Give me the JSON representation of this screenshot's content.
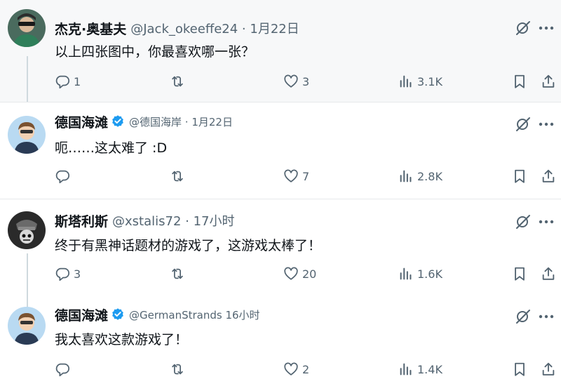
{
  "tweets": [
    {
      "name": "杰克·奥基夫",
      "handle": "@Jack_okeeffe24 · 1月22日",
      "verified": false,
      "text": "以上四张图中，你最喜欢哪一张？",
      "reply_count": "1",
      "retweet_count": "",
      "like_count": "3",
      "view_count": "3.1K"
    },
    {
      "name": "德国海滩",
      "handle": "@德国海岸 · 1月22日",
      "verified": true,
      "text": "呃……这太难了 :D",
      "reply_count": "",
      "retweet_count": "",
      "like_count": "7",
      "view_count": "2.8K"
    },
    {
      "name": "斯塔利斯",
      "handle": "@xstalis72 · 17小时",
      "verified": false,
      "text": "终于有黑神话题材的游戏了，这游戏太棒了！",
      "reply_count": "3",
      "retweet_count": "",
      "like_count": "20",
      "view_count": "1.6K"
    },
    {
      "name": "德国海滩",
      "handle": "@GermanStrands 16小时",
      "verified": true,
      "text": "我太喜欢这款游戏了！",
      "reply_count": "",
      "retweet_count": "",
      "like_count": "2",
      "view_count": "1.4K"
    }
  ],
  "icons": {
    "reply": "reply-icon",
    "retweet": "retweet-icon",
    "like": "heart-icon",
    "views": "views-icon",
    "bookmark": "bookmark-icon",
    "share": "share-icon",
    "grok": "grok-icon",
    "more": "more-icon",
    "verified": "verified-badge-icon"
  },
  "colors": {
    "text": "#0f1419",
    "secondary": "#536471",
    "verified": "#1d9bf0",
    "thread_line": "#cfd9de",
    "highlight_bg": "#f7f8f9"
  }
}
